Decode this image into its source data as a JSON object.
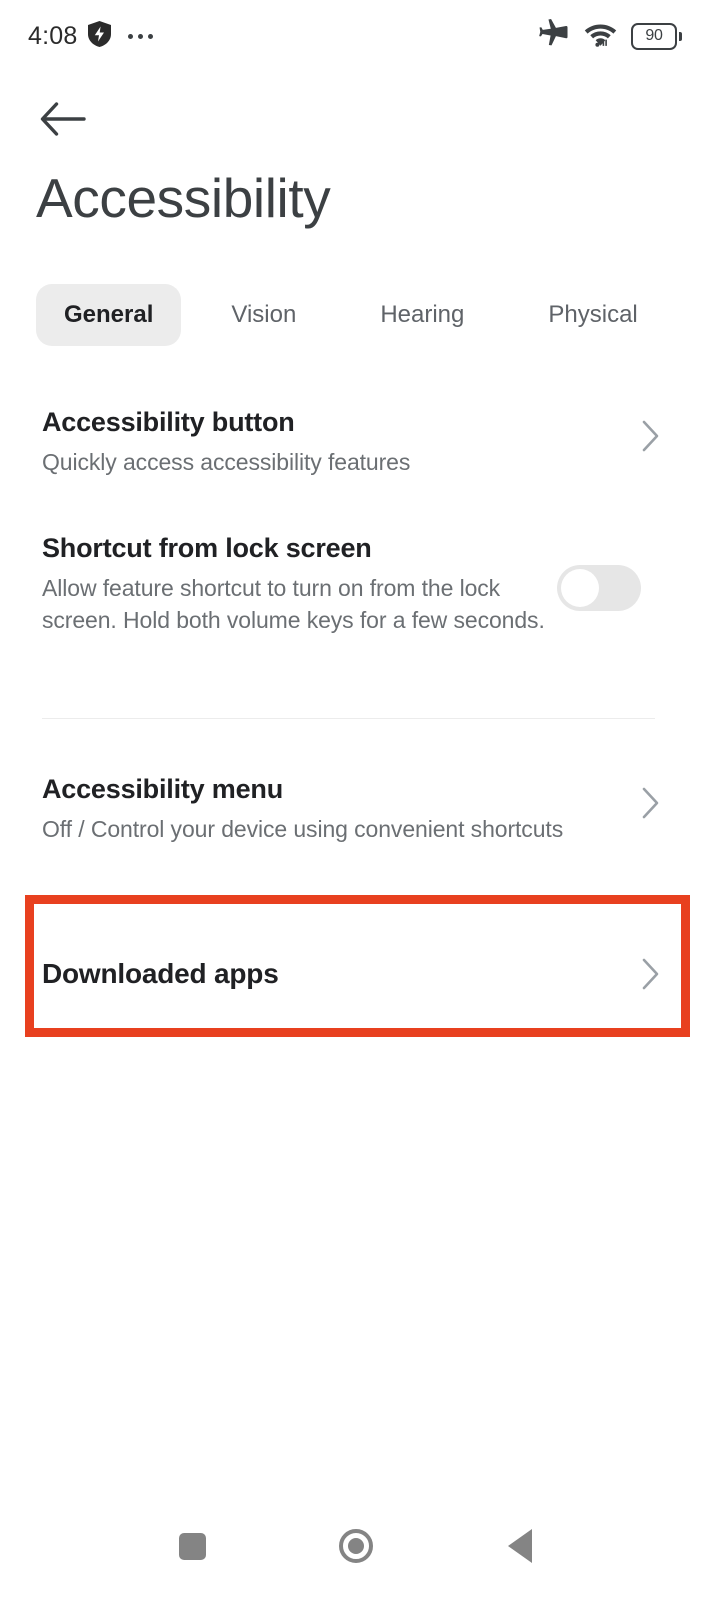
{
  "status_bar": {
    "time": "4:08",
    "shield_icon": "shield-bolt-icon",
    "more_icon": "more-dots-icon",
    "airplane_icon": "airplane-mode-icon",
    "wifi_icon": "wifi-icon",
    "battery_level": "90",
    "battery_icon": "battery-icon"
  },
  "header": {
    "back_icon": "back-arrow-icon",
    "title": "Accessibility"
  },
  "tabs": [
    {
      "label": "General",
      "selected": true
    },
    {
      "label": "Vision",
      "selected": false
    },
    {
      "label": "Hearing",
      "selected": false
    },
    {
      "label": "Physical",
      "selected": false
    }
  ],
  "settings": {
    "accessibility_button": {
      "title": "Accessibility button",
      "subtitle": "Quickly access accessibility features",
      "chevron_icon": "chevron-right-icon"
    },
    "shortcut_lock_screen": {
      "title": "Shortcut from lock screen",
      "subtitle": "Allow feature shortcut to turn on from the lock screen. Hold both volume keys for a few seconds.",
      "toggle_state": "off"
    },
    "accessibility_menu": {
      "title": "Accessibility menu",
      "subtitle": "Off / Control your device using convenient shortcuts",
      "chevron_icon": "chevron-right-icon"
    },
    "downloaded_apps": {
      "title": "Downloaded apps",
      "chevron_icon": "chevron-right-icon",
      "highlighted": true,
      "highlight_color": "#e8401f"
    }
  },
  "navigation_bar": {
    "recents_icon": "recents-square-icon",
    "home_icon": "home-circle-icon",
    "back_icon": "back-triangle-icon"
  },
  "colors": {
    "accent_highlight": "#e8401f",
    "tab_selected_bg": "#ececec",
    "text_primary": "#202124",
    "text_secondary": "#6b6f73",
    "nav_icon": "#848484"
  }
}
